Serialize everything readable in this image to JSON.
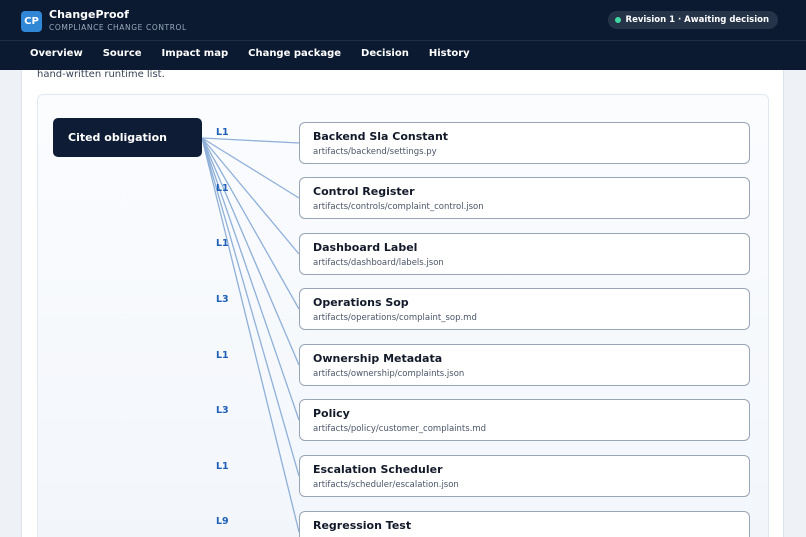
{
  "app": {
    "logo_text": "CP",
    "name": "ChangeProof",
    "tagline": "COMPLIANCE CHANGE CONTROL",
    "revision_badge": "Revision 1 · Awaiting decision",
    "status_color": "#3fd7a4"
  },
  "nav": [
    {
      "label": "Overview"
    },
    {
      "label": "Source"
    },
    {
      "label": "Impact map"
    },
    {
      "label": "Change package"
    },
    {
      "label": "Decision"
    },
    {
      "label": "History"
    }
  ],
  "page": {
    "subtitle": "hand-written runtime list."
  },
  "impact_map": {
    "source_label": "Cited obligation",
    "artifacts": [
      {
        "level": "L1",
        "title": "Backend Sla Constant",
        "path": "artifacts/backend/settings.py"
      },
      {
        "level": "L1",
        "title": "Control Register",
        "path": "artifacts/controls/complaint_control.json"
      },
      {
        "level": "L1",
        "title": "Dashboard Label",
        "path": "artifacts/dashboard/labels.json"
      },
      {
        "level": "L3",
        "title": "Operations Sop",
        "path": "artifacts/operations/complaint_sop.md"
      },
      {
        "level": "L1",
        "title": "Ownership Metadata",
        "path": "artifacts/ownership/complaints.json"
      },
      {
        "level": "L3",
        "title": "Policy",
        "path": "artifacts/policy/customer_complaints.md"
      },
      {
        "level": "L1",
        "title": "Escalation Scheduler",
        "path": "artifacts/scheduler/escalation.json"
      },
      {
        "level": "L9",
        "title": "Regression Test",
        "path": ""
      }
    ]
  },
  "colors": {
    "header_bg": "#0b1a30",
    "accent": "#2f87d6",
    "level_text": "#1e60b8",
    "edge": "#8fb0d8"
  }
}
